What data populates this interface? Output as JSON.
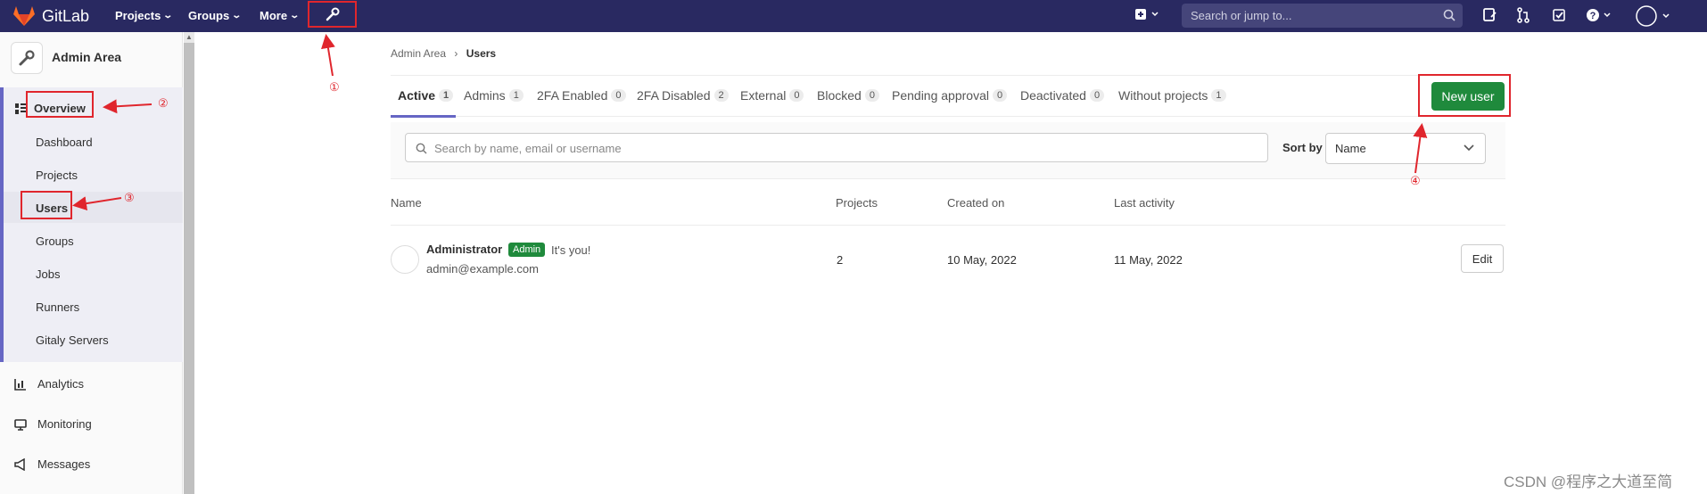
{
  "topbar": {
    "logo_text": "GitLab",
    "nav": [
      {
        "label": "Projects"
      },
      {
        "label": "Groups"
      },
      {
        "label": "More"
      }
    ],
    "search_placeholder": "Search or jump to..."
  },
  "sidebar": {
    "title": "Admin Area",
    "overview_label": "Overview",
    "items": [
      "Dashboard",
      "Projects",
      "Users",
      "Groups",
      "Jobs",
      "Runners",
      "Gitaly Servers"
    ],
    "sections": [
      {
        "label": "Analytics",
        "icon": "chart-icon"
      },
      {
        "label": "Monitoring",
        "icon": "monitor-icon"
      },
      {
        "label": "Messages",
        "icon": "megaphone-icon"
      }
    ]
  },
  "breadcrumb": {
    "parent": "Admin Area",
    "sep": "›",
    "current": "Users"
  },
  "tabs": [
    {
      "label": "Active",
      "count": "1"
    },
    {
      "label": "Admins",
      "count": "1"
    },
    {
      "label": "2FA Enabled",
      "count": "0"
    },
    {
      "label": "2FA Disabled",
      "count": "2"
    },
    {
      "label": "External",
      "count": "0"
    },
    {
      "label": "Blocked",
      "count": "0"
    },
    {
      "label": "Pending approval",
      "count": "0"
    },
    {
      "label": "Deactivated",
      "count": "0"
    },
    {
      "label": "Without projects",
      "count": "1"
    }
  ],
  "new_user_label": "New user",
  "filter": {
    "search_placeholder": "Search by name, email or username",
    "sort_label": "Sort by",
    "sort_value": "Name"
  },
  "table": {
    "headers": [
      "Name",
      "Projects",
      "Created on",
      "Last activity"
    ],
    "rows": [
      {
        "name": "Administrator",
        "badge": "Admin",
        "note": "It's you!",
        "email": "admin@example.com",
        "projects": "2",
        "created": "10 May, 2022",
        "last_activity": "11 May, 2022",
        "action": "Edit"
      }
    ]
  },
  "annotations": [
    "①",
    "②",
    "③",
    "④"
  ],
  "watermark": "CSDN @程序之大道至简",
  "colors": {
    "topbar": "#292961",
    "accent": "#6666c4",
    "success": "#1f8a3c",
    "annotation": "#e0262d"
  }
}
